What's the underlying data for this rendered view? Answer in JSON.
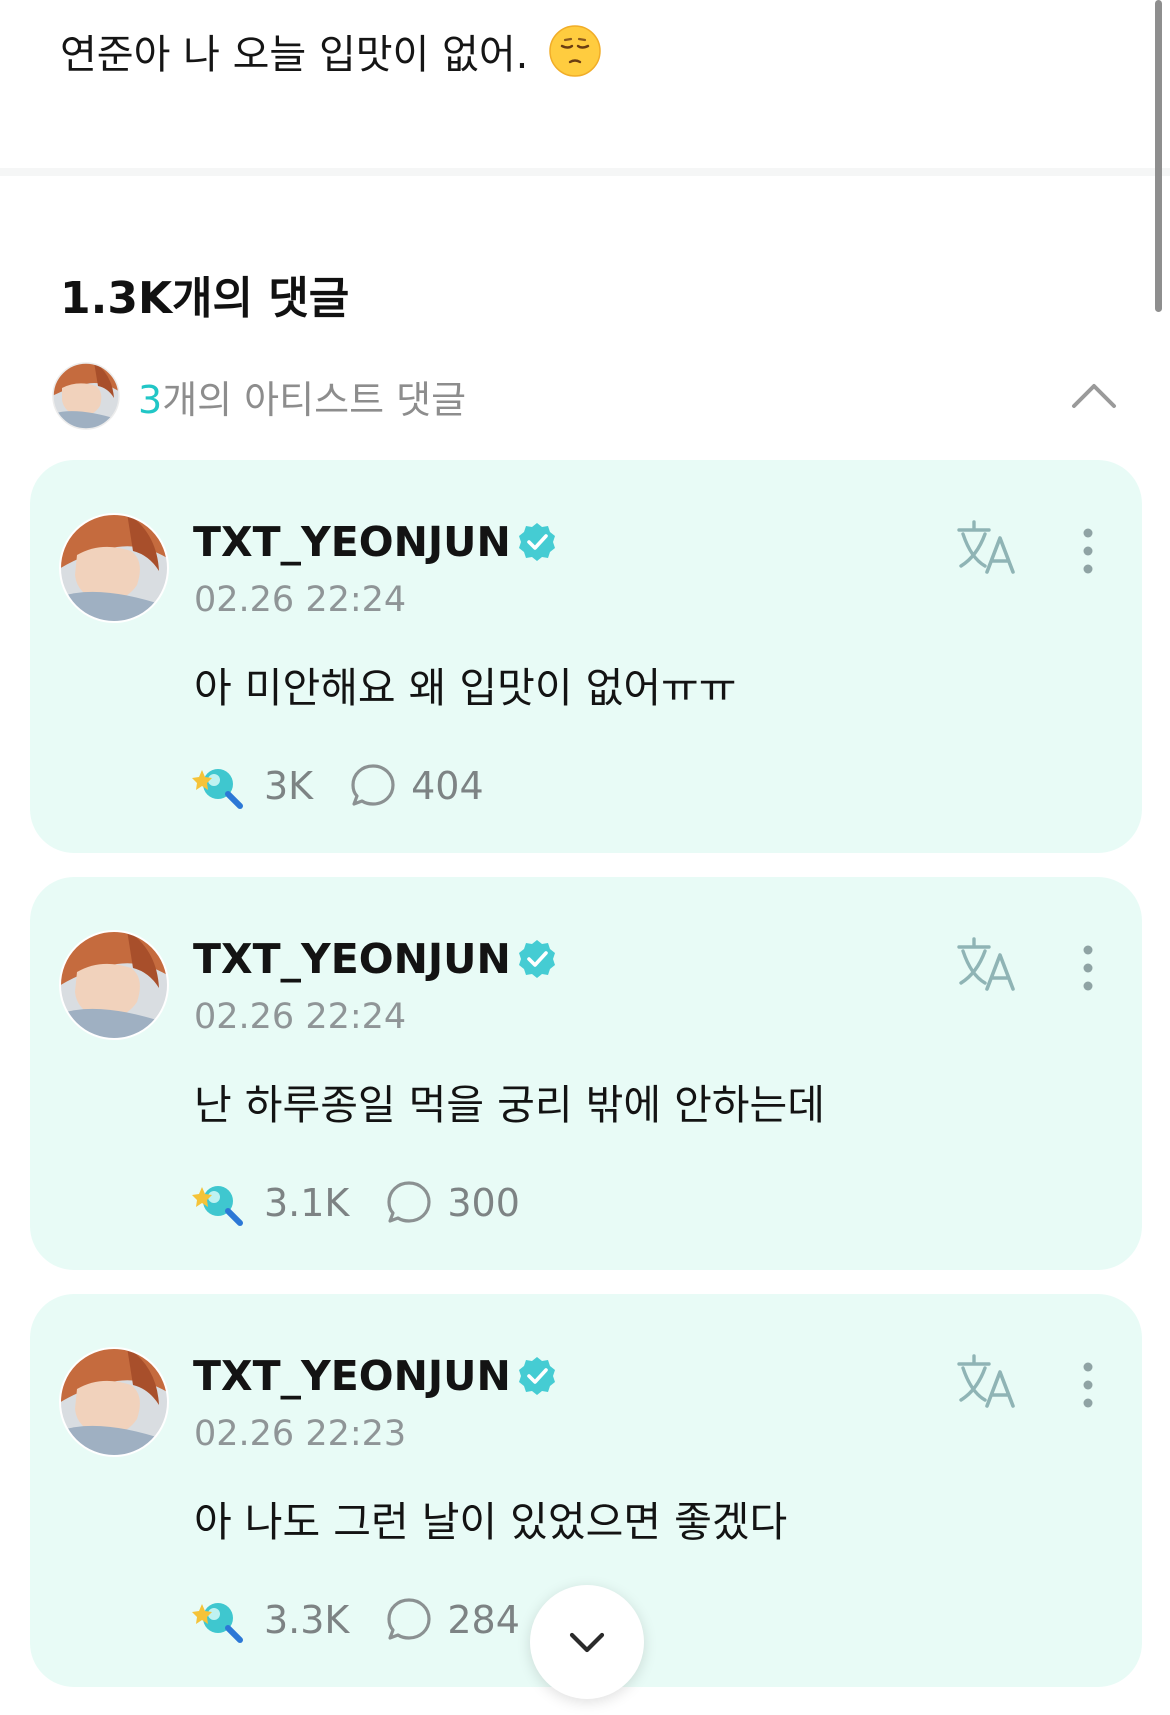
{
  "post": {
    "text": "연준아 나 오늘 입맛이 없어.",
    "emoji": "pensive-face-emoji"
  },
  "comments_header": {
    "title": "1.3K개의 댓글"
  },
  "artist_section": {
    "count": "3",
    "label": "개의 아티스트 댓글",
    "toggle_icon": "chevron-up-icon"
  },
  "comments": [
    {
      "username": "TXT_YEONJUN",
      "timestamp": "02.26 22:24",
      "text": "아 미안해요 왜 입맛이 없어ㅠㅠ",
      "likes": "3K",
      "replies": "404"
    },
    {
      "username": "TXT_YEONJUN",
      "timestamp": "02.26 22:24",
      "text": "난 하루종일 먹을 궁리 밖에 안하는데",
      "likes": "3.1K",
      "replies": "300"
    },
    {
      "username": "TXT_YEONJUN",
      "timestamp": "02.26 22:23",
      "text": "아 나도 그런 날이 있었으면 좋겠다",
      "likes": "3.3K",
      "replies": "284"
    }
  ],
  "colors": {
    "accent": "#21c6c6",
    "card_bg": "#e8fbf6",
    "verified": "#45ccd3"
  },
  "scroll_button_icon": "chevron-down-icon"
}
